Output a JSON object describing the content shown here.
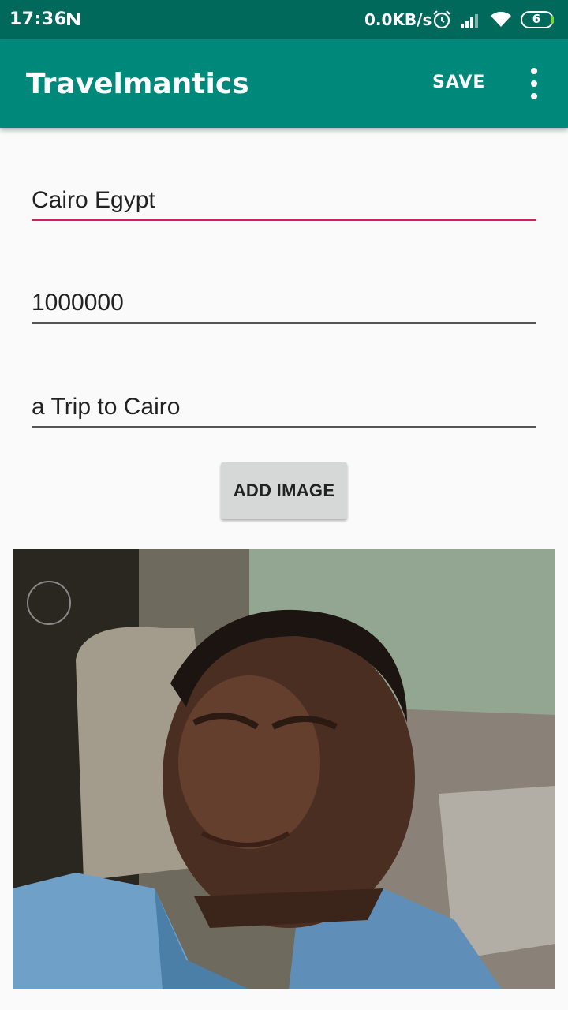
{
  "status_bar": {
    "time": "17:36",
    "network_speed": "0.0KB/s",
    "battery_level": "6",
    "icons": [
      "n-notification-icon",
      "alarm-icon",
      "signal-icon",
      "wifi-icon",
      "battery-icon"
    ]
  },
  "app_bar": {
    "title": "Travelmantics",
    "save_label": "SAVE",
    "menu_icon": "more-vert-icon"
  },
  "form": {
    "title_value": "Cairo Egypt",
    "price_value": "1000000",
    "description_value": "a Trip to Cairo",
    "add_image_label": "ADD IMAGE"
  },
  "colors": {
    "status_bar": "#00695c",
    "app_bar": "#00897b",
    "accent": "#d81b60",
    "button": "#d6d7d7"
  }
}
